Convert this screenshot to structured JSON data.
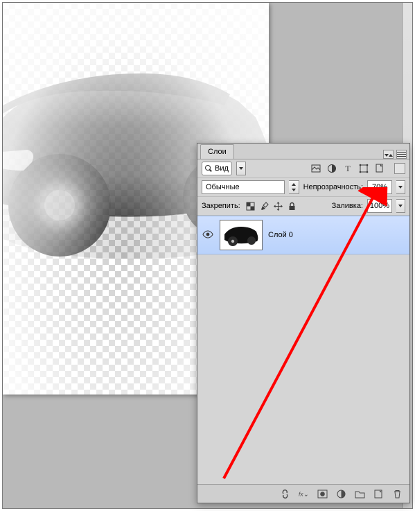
{
  "panel": {
    "tab_label": "Слои",
    "search": {
      "label": "Вид"
    },
    "blend_mode": "Обычные",
    "opacity": {
      "label": "Непрозрачность:",
      "value": "70%"
    },
    "fill": {
      "label": "Заливка:",
      "value": "100%"
    },
    "lock_label": "Закрепить:",
    "layer0": {
      "name": "Слой 0"
    },
    "icons": {
      "filter_image": "image-filter-icon",
      "filter_adjust": "adjust-filter-icon",
      "filter_text": "text-filter-icon",
      "filter_shape": "shape-filter-icon",
      "filter_smart": "smart-filter-icon",
      "lock_trans": "lock-transparency-icon",
      "lock_paint": "lock-paint-icon",
      "lock_move": "lock-move-icon",
      "lock_all": "lock-all-icon",
      "link": "link-icon",
      "fx": "fx-icon",
      "mask": "mask-icon",
      "adjustment": "adjustment-layer-icon",
      "group": "group-icon",
      "new": "new-layer-icon",
      "trash": "trash-icon"
    }
  }
}
